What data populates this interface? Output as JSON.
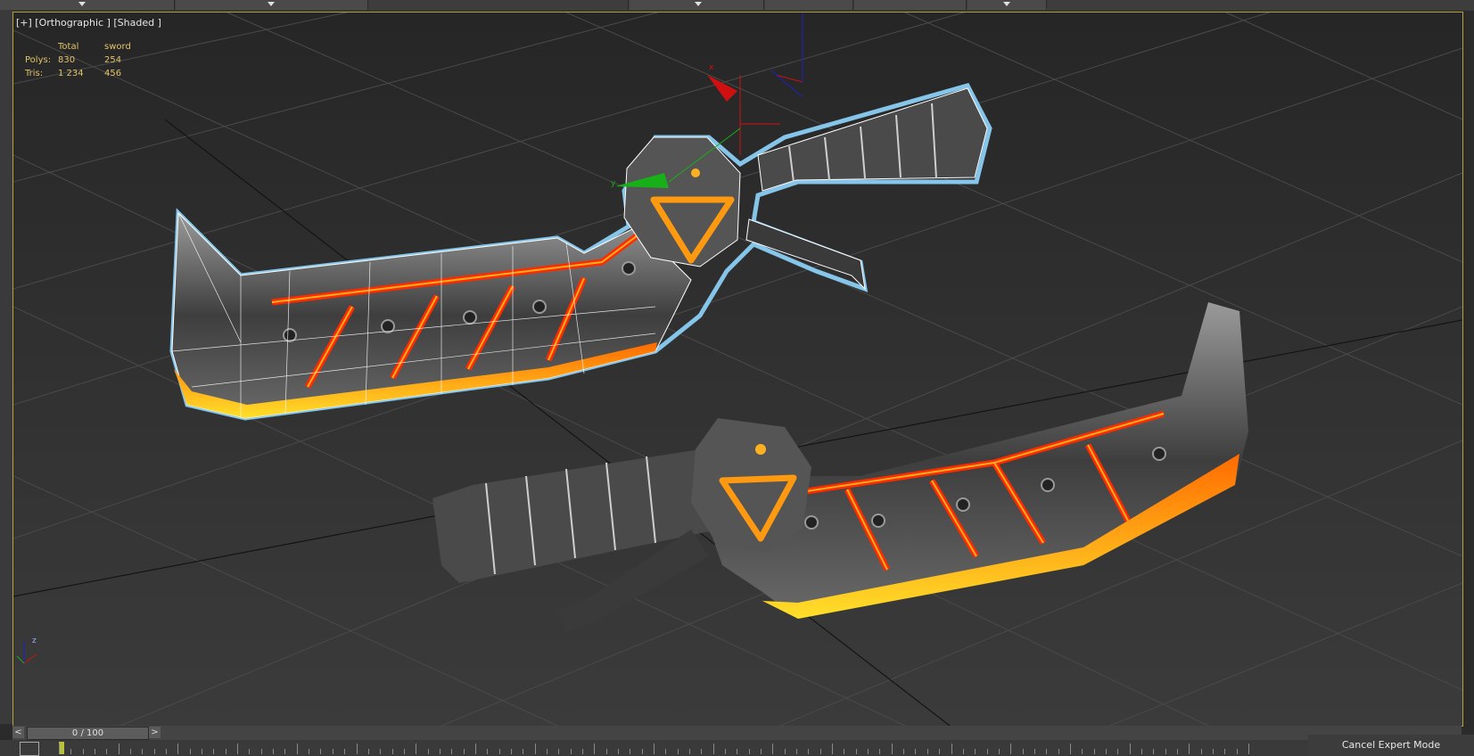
{
  "viewport": {
    "label": "[+] [Orthographic ] [Shaded ]",
    "stats": {
      "header_total": "Total",
      "header_object": "sword",
      "polys_label": "Polys:",
      "polys_total": "830",
      "polys_object": "254",
      "tris_label": "Tris:",
      "tris_total": "1 234",
      "tris_object": "456"
    },
    "axis_labels": {
      "x": "x",
      "y": "y",
      "z": "z"
    }
  },
  "timeline": {
    "prev_label": "<",
    "next_label": ">",
    "frame_label": "0 / 100",
    "frame_current": 0,
    "frame_total": 100
  },
  "status": {
    "cancel_expert_label": "Cancel Expert Mode"
  },
  "colors": {
    "selection_outline": "#8fd6ff",
    "glow_red": "#ff2200",
    "glow_yellow": "#ffd21a",
    "metal": "#5a5a5a",
    "gizmo_red": "#d01010",
    "gizmo_green": "#18b018",
    "gizmo_blue": "#2020c0"
  }
}
